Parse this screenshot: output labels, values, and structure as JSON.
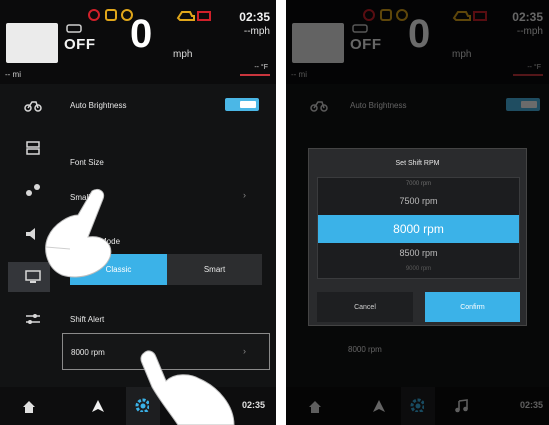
{
  "colors": {
    "accent": "#3bb2e8",
    "warning": "#d0202a",
    "amber": "#e0a61a",
    "background": "#121314"
  },
  "status_bar": {
    "gear_text": "OFF",
    "speed_value": "0",
    "speed_unit": "mph",
    "time": "02:35",
    "right_unit": "--mph",
    "odometer": "-- mi",
    "temperature": "-- °F"
  },
  "settings": {
    "auto_brightness_label": "Auto Brightness",
    "font_size_label": "Font Size",
    "font_size_value": "Small",
    "mode_label": "Mode",
    "mode_options": [
      "Classic",
      "Smart"
    ],
    "mode_selected": "Classic",
    "shift_alert_label": "Shift Alert",
    "shift_alert_value": "8000 rpm"
  },
  "bottom_bar": {
    "time": "02:35",
    "icons": [
      "home-icon",
      "navigation-arrow-icon",
      "settings-gear-icon",
      "music-note-icon"
    ]
  },
  "dialog": {
    "title": "Set Shift RPM",
    "options": [
      "7000 rpm",
      "7500 rpm",
      "8000 rpm",
      "8500 rpm",
      "9000 rpm"
    ],
    "selected": "8000 rpm",
    "cancel_label": "Cancel",
    "confirm_label": "Confirm"
  }
}
